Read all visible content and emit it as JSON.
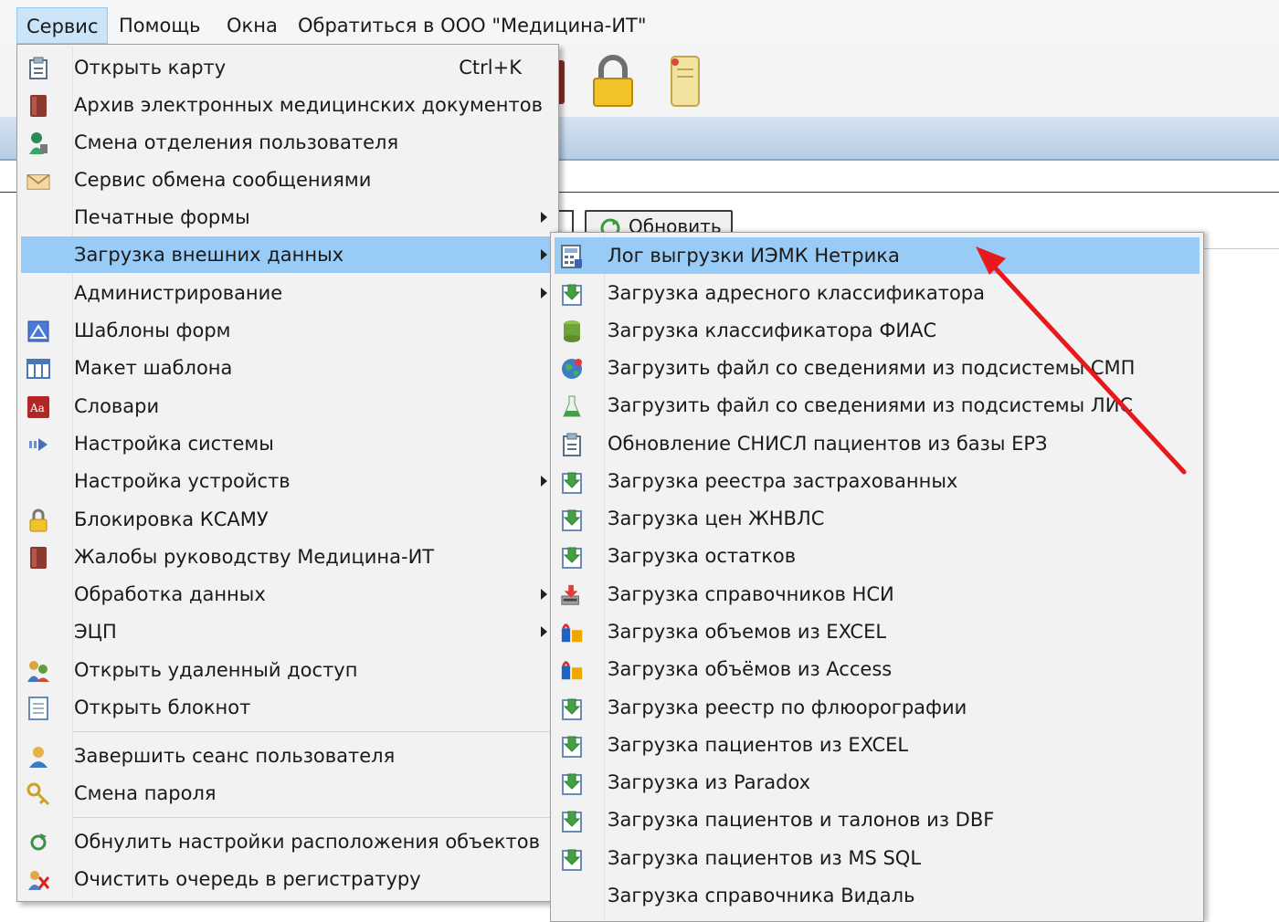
{
  "menubar": {
    "items": [
      "Сервис",
      "Помощь",
      "Окна",
      "Обратиться в ООО \"Медицина-ИТ\""
    ]
  },
  "toolbar": {
    "refresh_label": "Обновить",
    "icons": [
      "book-icon",
      "lock-icon",
      "scroll-icon"
    ]
  },
  "service_menu": {
    "items": [
      {
        "label": "Открыть карту",
        "shortcut": "Ctrl+K",
        "icon": "open-card-icon"
      },
      {
        "label": "Архив электронных медицинских документов",
        "icon": "archive-book-icon"
      },
      {
        "label": "Смена отделения пользователя",
        "icon": "user-switch-icon"
      },
      {
        "label": "Сервис обмена сообщениями",
        "icon": "envelope-icon"
      },
      {
        "label": "Печатные формы",
        "submenu": true
      },
      {
        "label": "Загрузка внешних данных",
        "submenu": true,
        "highlighted": true
      },
      {
        "label": "Администрирование",
        "submenu": true
      },
      {
        "label": "Шаблоны форм",
        "icon": "form-template-icon"
      },
      {
        "label": "Макет шаблона",
        "icon": "table-layout-icon"
      },
      {
        "label": "Словари",
        "icon": "dictionary-icon"
      },
      {
        "label": "Настройка системы",
        "icon": "settings-arrow-icon"
      },
      {
        "label": "Настройка устройств",
        "submenu": true
      },
      {
        "label": "Блокировка КСАМУ",
        "icon": "lock-icon"
      },
      {
        "label": "Жалобы руководству Медицина-ИТ",
        "icon": "complaint-book-icon"
      },
      {
        "label": "Обработка данных",
        "submenu": true
      },
      {
        "label": "ЭЦП",
        "submenu": true
      },
      {
        "label": "Открыть удаленный доступ",
        "icon": "remote-users-icon"
      },
      {
        "label": "Открыть блокнот",
        "icon": "notepad-icon"
      },
      {
        "label": "Завершить сеанс пользователя",
        "icon": "logout-user-icon"
      },
      {
        "label": "Смена пароля",
        "icon": "key-icon"
      },
      {
        "label": "Обнулить настройки расположения объектов",
        "icon": "reset-icon"
      },
      {
        "label": "Очистить очередь в регистратуру",
        "icon": "clear-queue-icon"
      }
    ]
  },
  "load_submenu": {
    "items": [
      {
        "label": "Лог выгрузки ИЭМК Нетрика",
        "icon": "calculator-log-icon",
        "highlighted": true
      },
      {
        "label": "Загрузка адресного классификатора",
        "icon": "download-doc-icon"
      },
      {
        "label": "Загрузка классификатора ФИАС",
        "icon": "database-icon"
      },
      {
        "label": "Загрузить файл со сведениями из подсистемы СМП",
        "icon": "globe-icon"
      },
      {
        "label": "Загрузить файл со сведениями из подсистемы ЛИС",
        "icon": "flask-icon"
      },
      {
        "label": "Обновление СНИСЛ пациентов из базы ЕРЗ",
        "icon": "clipboard-icon"
      },
      {
        "label": "Загрузка реестра застрахованных",
        "icon": "download-doc-icon"
      },
      {
        "label": "Загрузка цен ЖНВЛС",
        "icon": "download-doc-icon"
      },
      {
        "label": "Загрузка остатков",
        "icon": "download-doc-icon"
      },
      {
        "label": "Загрузка справочников НСИ",
        "icon": "install-icon"
      },
      {
        "label": "Загрузка объемов из EXCEL",
        "icon": "package-icon"
      },
      {
        "label": "Загрузка объёмов из Access",
        "icon": "package-icon"
      },
      {
        "label": "Загрузка реестр по флюорографии",
        "icon": "download-doc-icon"
      },
      {
        "label": "Загрузка пациентов из EXCEL",
        "icon": "download-doc-icon"
      },
      {
        "label": "Загрузка из Paradox",
        "icon": "download-doc-icon"
      },
      {
        "label": "Загрузка пациентов и талонов из DBF",
        "icon": "download-doc-icon"
      },
      {
        "label": "Загрузка пациентов из MS SQL",
        "icon": "download-doc-icon"
      },
      {
        "label": "Загрузка справочника Видаль"
      }
    ]
  },
  "colors": {
    "highlight": "#99cbf7",
    "menubar_active": "#cce4f7",
    "menu_bg": "#f2f2f2",
    "annotation_arrow": "#e8191c"
  }
}
